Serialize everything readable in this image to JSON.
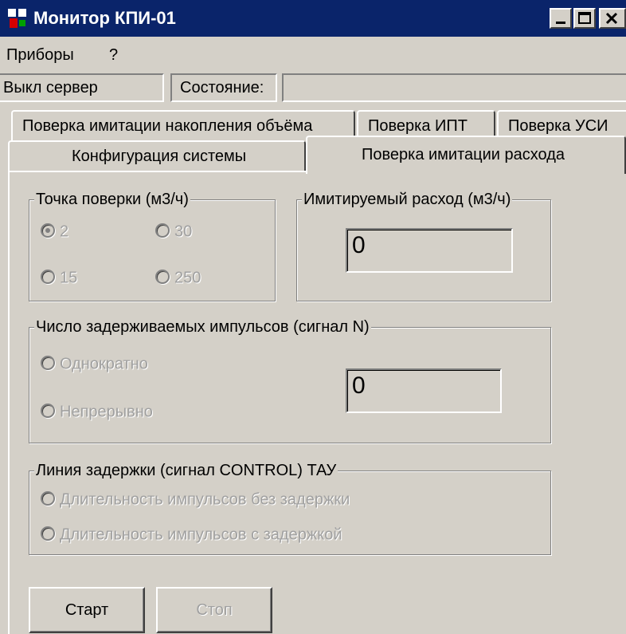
{
  "window": {
    "title": "Монитор КПИ-01",
    "colors": {
      "titlebar": "#0a246a",
      "face": "#d4d0c8"
    }
  },
  "menu": {
    "items": [
      "Приборы",
      "?"
    ]
  },
  "status": {
    "server_label": "Выкл сервер",
    "state_label": "Состояние:",
    "state_value": ""
  },
  "tabs": {
    "row_back": [
      "Поверка имитации накопления объёма",
      "Поверка ИПТ",
      "Поверка УСИ"
    ],
    "row_front": [
      "Конфигурация системы",
      "Поверка имитации расхода"
    ],
    "active": "Поверка имитации расхода"
  },
  "check_point": {
    "legend": "Точка поверки (м3/ч)",
    "options": [
      "2",
      "30",
      "15",
      "250"
    ],
    "selected": "2"
  },
  "simulated_rate": {
    "legend": "Имитируемый расход (м3/ч)",
    "value": "0"
  },
  "pulses": {
    "legend": "Число задерживаемых импульсов (сигнал N)",
    "options": [
      "Однократно",
      "Непрерывно"
    ],
    "value": "0"
  },
  "delay_line": {
    "legend": "Линия задержки (сигнал CONTROL) ТАУ",
    "options": [
      "Длительность импульсов без задержки",
      "Длительность импульсов с задержкой"
    ]
  },
  "buttons": {
    "start": "Старт",
    "stop": "Стоп"
  },
  "icons": {
    "app": "app-logo-icon",
    "minimize": "minimize-icon",
    "maximize": "maximize-icon",
    "close": "close-icon"
  }
}
